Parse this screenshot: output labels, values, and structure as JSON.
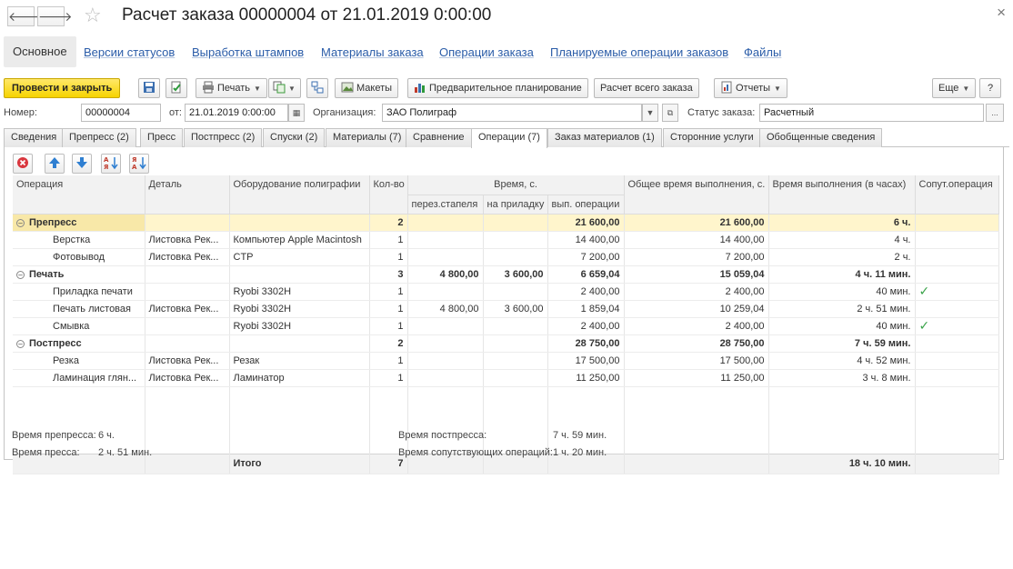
{
  "window": {
    "title": "Расчет заказа 00000004 от 21.01.2019 0:00:00",
    "back_glyph": "🡐",
    "forward_glyph": "🡒",
    "close_glyph": "×"
  },
  "section_tabs": [
    "Основное",
    "Версии статусов",
    "Выработка штампов",
    "Материалы заказа",
    "Операции заказа",
    "Планируемые операции заказов",
    "Файлы"
  ],
  "toolbar": {
    "post_close": "Провести и закрыть",
    "print": "Печать",
    "layouts": "Макеты",
    "preplanning": "Предварительное планирование",
    "calc_all": "Расчет всего заказа",
    "reports": "Отчеты",
    "more": "Еще",
    "help": "?"
  },
  "form": {
    "number_label": "Номер:",
    "number_value": "00000004",
    "date_label": "от:",
    "date_value": "21.01.2019  0:00:00",
    "org_label": "Организация:",
    "org_value": "ЗАО Полиграф",
    "status_label": "Статус заказа:",
    "status_value": "Расчетный",
    "ellipsis": "..."
  },
  "object_tabs": [
    "Сведения",
    "Препресс (2)",
    "Пресс",
    "Постпресс (2)",
    "Спуски (2)",
    "Материалы (7)",
    "Сравнение",
    "Операции (7)",
    "Заказ материалов (1)",
    "Сторонние услуги",
    "Обобщенные сведения"
  ],
  "table": {
    "headers": {
      "operation": "Операция",
      "detail": "Деталь",
      "equipment": "Оборудование полиграфии",
      "qty": "Кол-во",
      "time_group": "Время, с.",
      "time_stack": "перез.стапеля",
      "time_makeready": "на приладку",
      "time_exec": "вып. операции",
      "total_time": "Общее время выполнения, с.",
      "hours": "Время выполнения (в часах)",
      "accompanying": "Сопут.операция"
    },
    "rows": [
      {
        "op": "Препресс",
        "detail": "",
        "equip": "",
        "qty": "2",
        "stack": "",
        "makeready": "",
        "exec": "21 600,00",
        "total": "21 600,00",
        "hours": "6 ч.",
        "acc": "",
        "group": true,
        "toggle": "⊖"
      },
      {
        "op": "Верстка",
        "detail": "Листовка Рек...",
        "equip": "Компьютер Apple Macintosh",
        "qty": "1",
        "stack": "",
        "makeready": "",
        "exec": "14 400,00",
        "total": "14 400,00",
        "hours": "4 ч.",
        "acc": ""
      },
      {
        "op": "Фотовывод",
        "detail": "Листовка Рек...",
        "equip": "CTP",
        "qty": "1",
        "stack": "",
        "makeready": "",
        "exec": "7 200,00",
        "total": "7 200,00",
        "hours": "2 ч.",
        "acc": ""
      },
      {
        "op": "Печать",
        "detail": "",
        "equip": "",
        "qty": "3",
        "stack": "4 800,00",
        "makeready": "3 600,00",
        "exec": "6 659,04",
        "total": "15 059,04",
        "hours": "4 ч. 11 мин.",
        "acc": "",
        "group": true,
        "toggle": "⊖"
      },
      {
        "op": "Приладка печати",
        "detail": "",
        "equip": "Ryobi 3302H",
        "qty": "1",
        "stack": "",
        "makeready": "",
        "exec": "2 400,00",
        "total": "2 400,00",
        "hours": "40 мин.",
        "acc": "✓"
      },
      {
        "op": "Печать листовая",
        "detail": "Листовка Рек...",
        "equip": "Ryobi 3302H",
        "qty": "1",
        "stack": "4 800,00",
        "makeready": "3 600,00",
        "exec": "1 859,04",
        "total": "10 259,04",
        "hours": "2 ч. 51 мин.",
        "acc": ""
      },
      {
        "op": "Смывка",
        "detail": "",
        "equip": "Ryobi 3302H",
        "qty": "1",
        "stack": "",
        "makeready": "",
        "exec": "2 400,00",
        "total": "2 400,00",
        "hours": "40 мин.",
        "acc": "✓"
      },
      {
        "op": "Постпресс",
        "detail": "",
        "equip": "",
        "qty": "2",
        "stack": "",
        "makeready": "",
        "exec": "28 750,00",
        "total": "28 750,00",
        "hours": "7 ч. 59 мин.",
        "acc": "",
        "group": true,
        "toggle": "⊖"
      },
      {
        "op": "Резка",
        "detail": "Листовка Рек...",
        "equip": "Резак",
        "qty": "1",
        "stack": "",
        "makeready": "",
        "exec": "17 500,00",
        "total": "17 500,00",
        "hours": "4 ч. 52 мин.",
        "acc": ""
      },
      {
        "op": "Ламинация глян...",
        "detail": "Листовка Рек...",
        "equip": "Ламинатор",
        "qty": "1",
        "stack": "",
        "makeready": "",
        "exec": "11 250,00",
        "total": "11 250,00",
        "hours": "3 ч. 8 мин.",
        "acc": ""
      }
    ],
    "total": {
      "label": "Итого",
      "qty": "7",
      "hours": "18 ч. 10 мин."
    }
  },
  "footer": {
    "prepress_label": "Время препресса:",
    "prepress_value": "6 ч.",
    "press_label": "Время пресса:",
    "press_value": "2 ч. 51 мин.",
    "postpress_label": "Время постпресса:",
    "postpress_value": "7 ч. 59 мин.",
    "accomp_label": "Время сопутствующих операций:",
    "accomp_value": "1 ч. 20 мин."
  },
  "colors": {
    "primary_button": "#f6d300",
    "link": "#2a5ca8",
    "selected_row": "#fff5cc",
    "check": "#3aa34a"
  }
}
